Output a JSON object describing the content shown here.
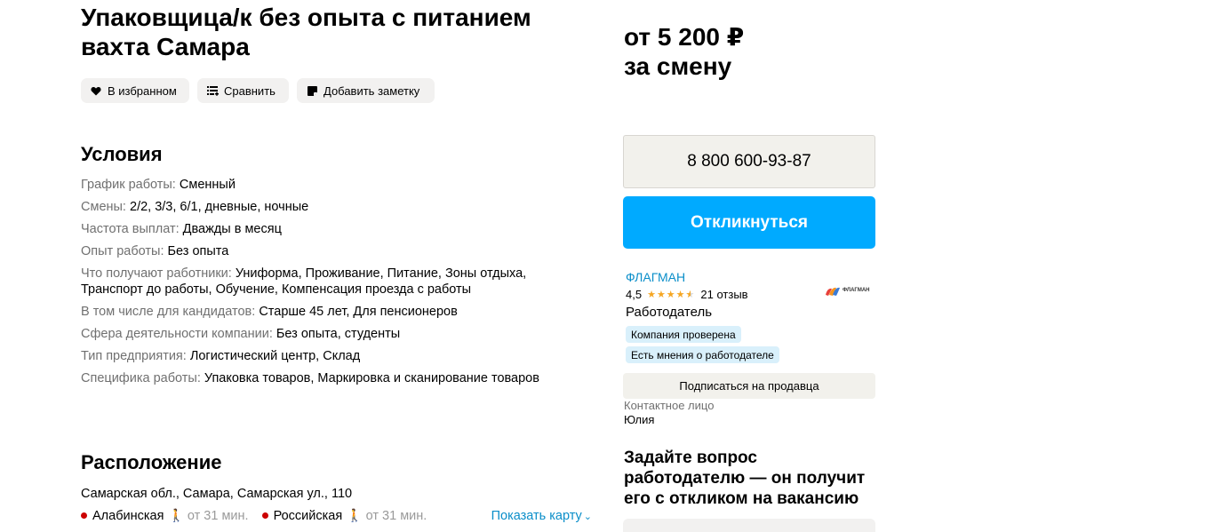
{
  "vacancy": {
    "title": "Упаковщица/к без опыта с питанием вахта Самара"
  },
  "actions": {
    "favorite_label": "В избранном",
    "compare_label": "Сравнить",
    "note_label": "Добавить заметку"
  },
  "conditions": {
    "title": "Условия",
    "rows": [
      {
        "label": "График работы:",
        "value": "Сменный"
      },
      {
        "label": "Смены:",
        "value": "2/2, 3/3, 6/1, дневные, ночные"
      },
      {
        "label": "Частота выплат:",
        "value": "Дважды в месяц"
      },
      {
        "label": "Опыт работы:",
        "value": "Без опыта"
      },
      {
        "label": "Что получают работники:",
        "value": "Униформа, Проживание, Питание, Зоны отдыха, Транспорт до работы, Обучение, Компенсация проезда с работы"
      },
      {
        "label": "В том числе для кандидатов:",
        "value": "Старше 45 лет, Для пенсионеров"
      },
      {
        "label": "Сфера деятельности компании:",
        "value": "Без опыта, студенты"
      },
      {
        "label": "Тип предприятия:",
        "value": "Логистический центр, Склад"
      },
      {
        "label": "Специфика работы:",
        "value": "Упаковка товаров, Маркировка и сканирование товаров"
      }
    ]
  },
  "location": {
    "title": "Расположение",
    "address": "Самарская обл., Самара, Самарская ул., 110",
    "metro": [
      {
        "station": "Алабинская",
        "time": "от 31 мин."
      },
      {
        "station": "Российская",
        "time": "от 31 мин."
      }
    ],
    "show_map_label": "Показать карту"
  },
  "sidebar": {
    "price_line1": "от 5 200 ₽",
    "price_line2": "за смену",
    "phone": "8 800 600-93-87",
    "respond_label": "Откликнуться",
    "company": {
      "name": "ФЛАГМАН",
      "rating": "4,5",
      "stars": 4.5,
      "reviews": "21 отзыв",
      "role": "Работодатель",
      "logo_text": "ФЛАГМАН",
      "badges": [
        "Компания проверена",
        "Есть мнения о работодателе"
      ]
    },
    "subscribe_label": "Подписаться на продавца",
    "contact_label": "Контактное лицо",
    "contact_name": "Юлия",
    "ask_title": "Задайте вопрос работодателю — он получит его с откликом на вакансию"
  },
  "colors": {
    "accent_blue": "#00aaff",
    "link_blue": "#0a8ec9",
    "metro_red": "#cc0000",
    "star_orange": "#f5a623",
    "badge_bg": "#d9f0fb"
  }
}
